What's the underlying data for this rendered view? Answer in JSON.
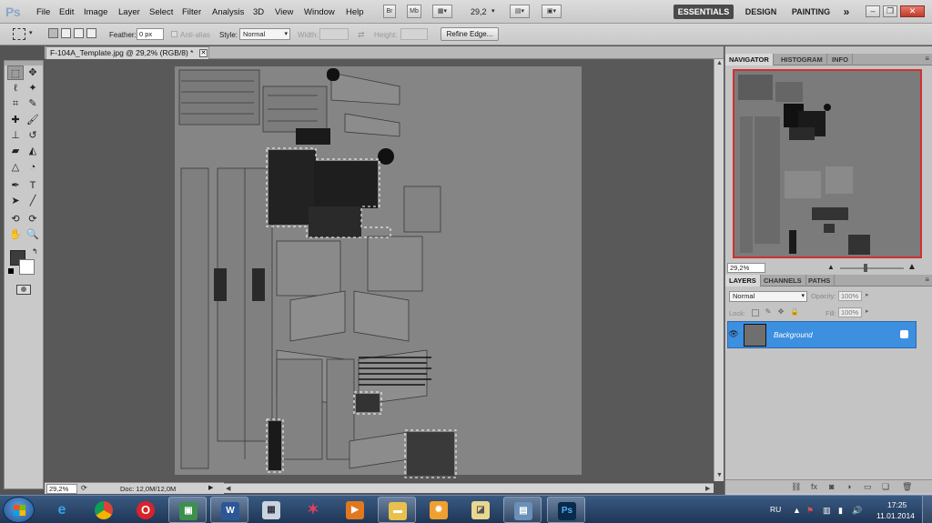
{
  "app": {
    "logo": "Ps",
    "menus": [
      "File",
      "Edit",
      "Image",
      "Layer",
      "Select",
      "Filter",
      "Analysis",
      "3D",
      "View",
      "Window",
      "Help"
    ],
    "bridge_label": "Br",
    "minibridge_label": "Mb",
    "zoom_value": "29,2",
    "workspaces": [
      "ESSENTIALS",
      "DESIGN",
      "PAINTING"
    ],
    "more_workspaces": "»"
  },
  "options": {
    "feather_label": "Feather:",
    "feather_value": "0 px",
    "antialias_label": "Anti-alias",
    "style_label": "Style:",
    "style_value": "Normal",
    "width_label": "Width:",
    "height_label": "Height:",
    "refine_edge": "Refine Edge..."
  },
  "document": {
    "tab_title": "F-104A_Template.jpg @ 29,2% (RGB/8) *",
    "status_zoom": "29,2%",
    "status_doc": "Doc: 12,0M/12,0M"
  },
  "navigator": {
    "tabs": [
      "NAVIGATOR",
      "HISTOGRAM",
      "INFO"
    ],
    "zoom": "29,2%"
  },
  "layers": {
    "tabs": [
      "LAYERS",
      "CHANNELS",
      "PATHS"
    ],
    "blend_mode": "Normal",
    "opacity_label": "Opacity:",
    "opacity_value": "100%",
    "lock_label": "Lock:",
    "fill_label": "Fill:",
    "fill_value": "100%",
    "items": [
      {
        "name": "Background",
        "selected": true,
        "visible": true,
        "locked": true
      }
    ]
  },
  "taskbar": {
    "apps": [
      "windows-explorer-ie",
      "chrome",
      "opera",
      "utility",
      "word",
      "calculator",
      "network-app",
      "media-player",
      "folder",
      "paint",
      "file-manager",
      "remote",
      "photoshop"
    ],
    "language": "RU",
    "time": "17:25",
    "date": "11.01.2014"
  },
  "colors": {
    "accent_selection": "#3d8fe0",
    "foreground": "#3c3c3c",
    "background": "#ffffff"
  }
}
